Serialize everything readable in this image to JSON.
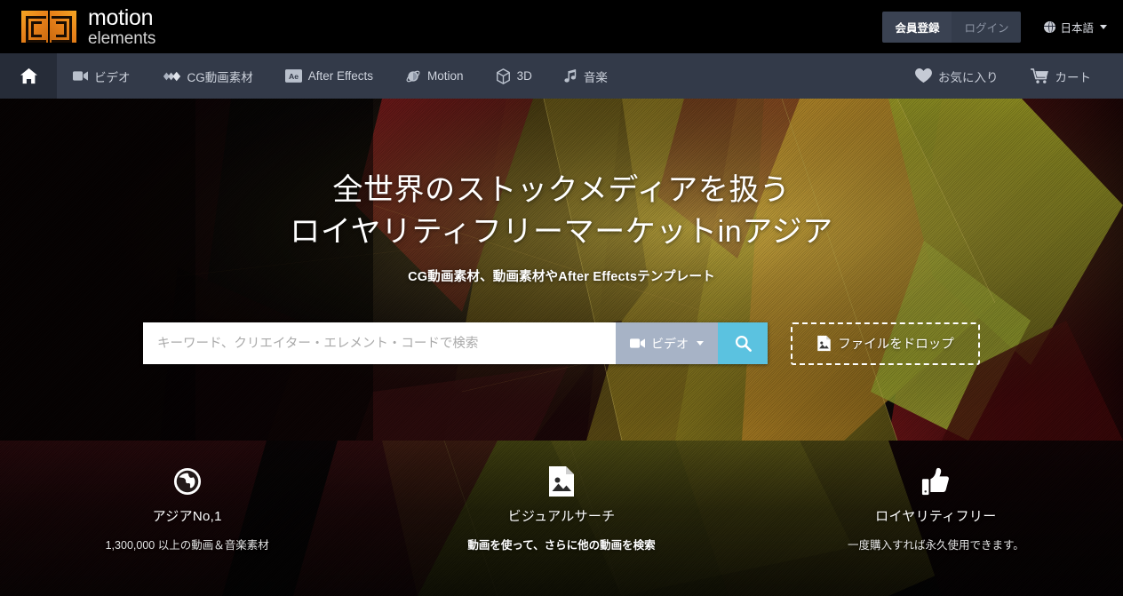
{
  "brand": {
    "name_line1": "motion",
    "name_line2": "elements",
    "logo_icon": "motion-elements-squares-logo",
    "accent_orange": "#e8821a"
  },
  "topbar": {
    "register_label": "会員登録",
    "login_label": "ログイン",
    "language_label": "日本語",
    "language_icon": "globe-icon",
    "caret_icon": "chevron-down-icon",
    "background": "#000000"
  },
  "nav": {
    "background": "#333a49",
    "home_icon": "home-icon",
    "items": [
      {
        "label": "ビデオ",
        "icon": "video-camera-icon"
      },
      {
        "label": "CG動画素材",
        "icon": "layered-diamonds-icon"
      },
      {
        "label": "After Effects",
        "icon": "after-effects-ae-icon"
      },
      {
        "label": "Motion",
        "icon": "motion-orbit-icon"
      },
      {
        "label": "3D",
        "icon": "cube-icon"
      },
      {
        "label": "音楽",
        "icon": "music-note-icon"
      }
    ],
    "right_items": [
      {
        "label": "お気に入り",
        "icon": "heart-icon"
      },
      {
        "label": "カート",
        "icon": "shopping-cart-icon"
      }
    ]
  },
  "hero": {
    "headline_line1": "全世界のストックメディアを扱う",
    "headline_line2": "ロイヤリティフリーマーケットinアジア",
    "subheadline": "CG動画素材、動画素材やAfter Effectsテンプレート",
    "search": {
      "placeholder": "キーワード、クリエイター・エレメント・コードで検索",
      "value": "",
      "type_label": "ビデオ",
      "type_icon": "video-camera-icon",
      "type_caret_icon": "chevron-down-icon",
      "search_icon": "search-icon",
      "search_button_color": "#5bc2e0",
      "type_button_color": "#a7b3c6"
    },
    "dropzone": {
      "label": "ファイルをドロップ",
      "icon": "image-file-icon"
    }
  },
  "features": [
    {
      "icon": "globe-icon",
      "title": "アジアNo,1",
      "desc": "1,300,000 以上の動画＆音楽素材"
    },
    {
      "icon": "image-file-icon",
      "title": "ビジュアルサーチ",
      "desc": "動画を使って、さらに他の動画を検索"
    },
    {
      "icon": "thumbs-up-icon",
      "title": "ロイヤリティフリー",
      "desc": "一度購入すれば永久使用できます。"
    }
  ]
}
